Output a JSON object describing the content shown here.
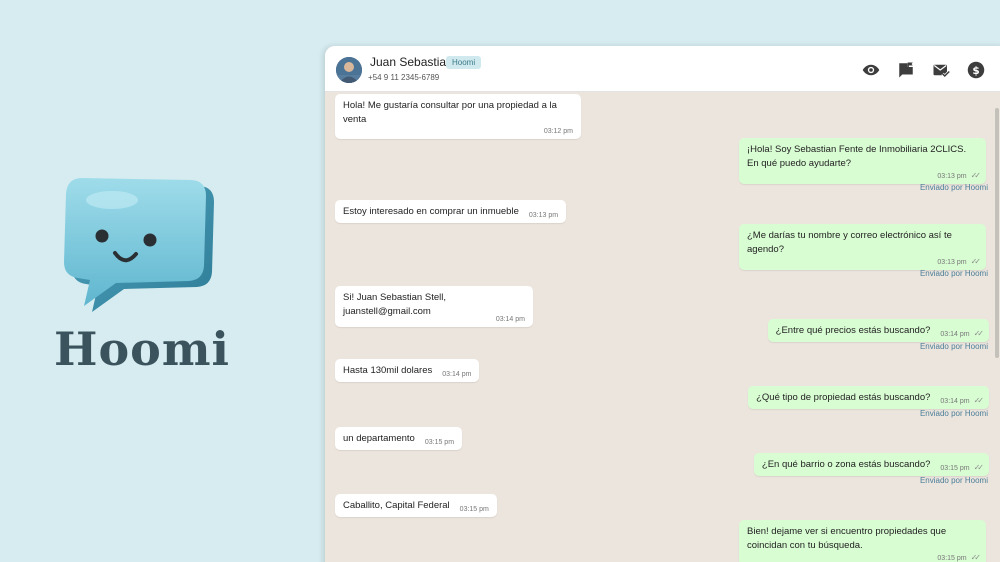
{
  "brand": {
    "name": "Hoomi"
  },
  "header": {
    "contact_name": "Juan Sebastian",
    "badge": "Hoomi",
    "phone": "+54 9 11 2345-6789",
    "icons": [
      "eye-icon",
      "chat-flag-icon",
      "mail-check-icon",
      "dollar-icon"
    ]
  },
  "messages": [
    {
      "dir": "in",
      "text": "Hola! Me gustaría consultar por una propiedad a la venta",
      "time": "03:12 pm"
    },
    {
      "dir": "out",
      "text": "¡Hola! Soy Sebastian Fente de Inmobiliaria 2CLICS. En qué puedo ayudarte?",
      "time": "03:13 pm",
      "via": "Enviado por Hoomi"
    },
    {
      "dir": "in",
      "text": "Estoy interesado en comprar un inmueble",
      "time": "03:13 pm"
    },
    {
      "dir": "out",
      "text": "¿Me darías tu nombre y correo electrónico así te agendo?",
      "time": "03:13 pm",
      "via": "Enviado por Hoomi"
    },
    {
      "dir": "in",
      "text": "Si! Juan Sebastian Stell, juanstell@gmail.com",
      "time": "03:14 pm"
    },
    {
      "dir": "out",
      "text": "¿Entre qué precios estás buscando?",
      "time": "03:14 pm",
      "via": "Enviado por Hoomi"
    },
    {
      "dir": "in",
      "text": "Hasta 130mil dolares",
      "time": "03:14 pm"
    },
    {
      "dir": "out",
      "text": "¿Qué tipo de propiedad estás buscando?",
      "time": "03:14 pm",
      "via": "Enviado por Hoomi"
    },
    {
      "dir": "in",
      "text": "un departamento",
      "time": "03:15 pm"
    },
    {
      "dir": "out",
      "text": "¿En qué barrio o zona estás buscando?",
      "time": "03:15 pm",
      "via": "Enviado por Hoomi"
    },
    {
      "dir": "in",
      "text": "Caballito, Capital Federal",
      "time": "03:15 pm"
    },
    {
      "dir": "out",
      "text": "Bien! dejame ver si encuentro propiedades que coincidan con tu búsqueda.",
      "time": "03:15 pm"
    }
  ],
  "colors": {
    "background": "#d6ecf0",
    "chat_background": "#ece5dd",
    "incoming_bubble": "#ffffff",
    "outgoing_bubble": "#d9fdd3",
    "brand_text": "#3a535d",
    "logo": "#7cc8dc"
  }
}
